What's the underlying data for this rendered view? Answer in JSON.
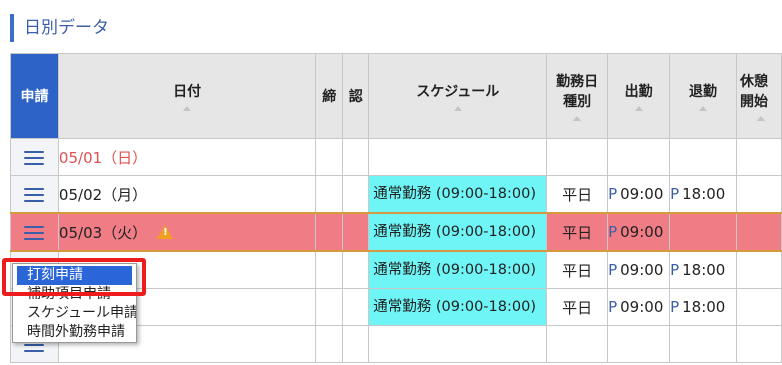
{
  "section_title": "日別データ",
  "headers": {
    "apply": "申請",
    "date": "日付",
    "close": "締",
    "approve": "認",
    "schedule": "スケジュール",
    "daytype_line1": "勤務日",
    "daytype_line2": "種別",
    "in": "出勤",
    "out": "退勤",
    "break_line1": "休憩",
    "break_line2": "開始"
  },
  "rows": [
    {
      "date": "05/01（日）",
      "schedule": "",
      "daytype": "",
      "in": "",
      "out": ""
    },
    {
      "date": "05/02（月）",
      "schedule": "通常勤務 (09:00-18:00)",
      "daytype": "平日",
      "in_prefix": "P",
      "in": "09:00",
      "out_prefix": "P",
      "out": "18:00"
    },
    {
      "date": "05/03（火）",
      "schedule": "通常勤務 (09:00-18:00)",
      "daytype": "平日",
      "in_prefix": "P",
      "in": "09:00",
      "out": ""
    },
    {
      "date": "",
      "schedule": "通常勤務 (09:00-18:00)",
      "daytype": "平日",
      "in_prefix": "P",
      "in": "09:00",
      "out_prefix": "P",
      "out": "18:00"
    },
    {
      "date": "",
      "schedule": "通常勤務 (09:00-18:00)",
      "daytype": "平日",
      "in_prefix": "P",
      "in": "09:00",
      "out_prefix": "P",
      "out": "18:00"
    },
    {
      "date": "",
      "schedule": "",
      "daytype": "",
      "in": "",
      "out": ""
    }
  ],
  "warning_mark": "!",
  "dropdown": [
    "打刻申請",
    "補助項目申請",
    "スケジュール申請",
    "時間外勤務申請"
  ],
  "colors": {
    "accent": "#2d63c6",
    "schedule_bg": "#6ff5f5",
    "highlight_row": "#f07c86",
    "callout": "#ee1c1c"
  },
  "icons": {
    "menu": "hamburger-icon",
    "warning": "warning-icon",
    "sort": "sort-arrow-icon"
  }
}
